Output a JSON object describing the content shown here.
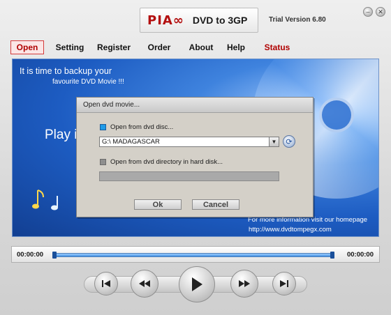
{
  "app": {
    "brand": "PIA∞",
    "product": "DVD to 3GP",
    "version": "Trial Version 6.80"
  },
  "window_controls": {
    "minimize_icon": "minimize-icon",
    "close_icon": "close-icon"
  },
  "menu": {
    "items": [
      {
        "label": "Open"
      },
      {
        "label": "Setting"
      },
      {
        "label": "Register"
      },
      {
        "label": "Order"
      },
      {
        "label": "About"
      },
      {
        "label": "Help"
      },
      {
        "label": "Status"
      }
    ],
    "active": "Open"
  },
  "banner": {
    "line1": "It is time to backup your",
    "line2": "favourite DVD Movie !!!",
    "play_text": "Play i",
    "more_info": "For more information visit our homepage",
    "url": "http://www.dvdtompegx.com"
  },
  "dialog": {
    "title": "Open dvd movie...",
    "option_disc": "Open from dvd disc...",
    "option_dir": "Open from dvd directory in hard disk...",
    "drive_value": "G:\\ MADAGASCAR",
    "ok": "Ok",
    "cancel": "Cancel"
  },
  "player": {
    "time_start": "00:00:00",
    "time_end": "00:00:00",
    "position": 0
  },
  "colors": {
    "brand_red": "#b30f0f",
    "status_red": "#b00000",
    "banner_blue": "#1d5cc2",
    "radio_on": "#1e9be8"
  }
}
